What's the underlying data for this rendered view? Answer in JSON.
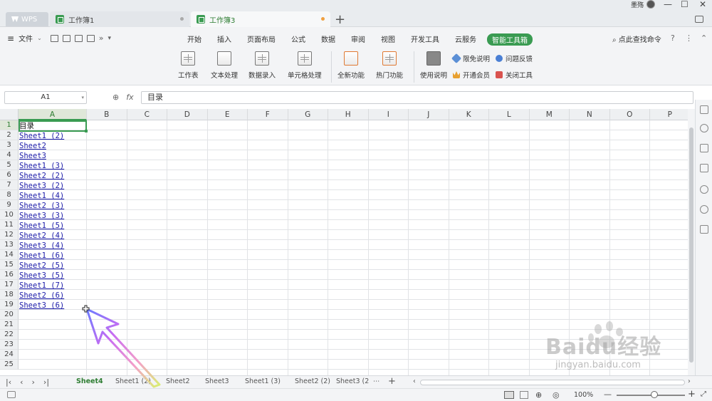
{
  "titlebar": {
    "tabs": [
      {
        "label": "WPS"
      },
      {
        "label": "工作簿1"
      },
      {
        "label": "工作簿3"
      }
    ],
    "user_name": "墨殇"
  },
  "ribbon": {
    "file_menu": "文件",
    "menu_tabs": [
      "开始",
      "插入",
      "页面布局",
      "公式",
      "数据",
      "审阅",
      "视图",
      "开发工具",
      "云服务",
      "智能工具箱"
    ],
    "active_tab": "智能工具箱",
    "search_placeholder": "点此查找命令",
    "groups": [
      {
        "label": "工作表",
        "icon": "worksheet-icon"
      },
      {
        "label": "文本处理",
        "icon": "text-process-icon"
      },
      {
        "label": "数据录入",
        "icon": "data-entry-icon"
      },
      {
        "label": "单元格处理",
        "icon": "cell-process-icon"
      },
      {
        "label": "全新功能",
        "icon": "new-features-icon"
      },
      {
        "label": "热门功能",
        "icon": "hot-features-icon"
      },
      {
        "label": "使用说明",
        "icon": "manual-icon"
      }
    ],
    "small_items": {
      "limited_free": "限免说明",
      "feedback": "问题反馈",
      "vip": "开通会员",
      "close_tools": "关闭工具"
    }
  },
  "formula_bar": {
    "name_box": "A1",
    "fx_label": "fx",
    "formula": "目录"
  },
  "grid": {
    "columns": [
      "A",
      "B",
      "C",
      "D",
      "E",
      "F",
      "G",
      "H",
      "I",
      "J",
      "K",
      "L",
      "M",
      "N",
      "O",
      "P"
    ],
    "rows": [
      "1",
      "2",
      "3",
      "4",
      "5",
      "6",
      "7",
      "8",
      "9",
      "10",
      "11",
      "12",
      "13",
      "14",
      "15",
      "16",
      "17",
      "18",
      "19",
      "20",
      "21",
      "22",
      "23",
      "24",
      "25"
    ],
    "cells_A": [
      "目录",
      "Sheet1 (2)",
      "Sheet2",
      "Sheet3",
      "Sheet1 (3)",
      "Sheet2 (2)",
      "Sheet3 (2)",
      "Sheet1 (4)",
      "Sheet2 (3)",
      "Sheet3 (3)",
      "Sheet1 (5)",
      "Sheet2 (4)",
      "Sheet3 (4)",
      "Sheet1 (6)",
      "Sheet2 (5)",
      "Sheet3 (5)",
      "Sheet1 (7)",
      "Sheet2 (6)",
      "Sheet3 (6)"
    ]
  },
  "sheet_tabs": [
    "Sheet4",
    "Sheet1 (2)",
    "Sheet2",
    "Sheet3",
    "Sheet1 (3)",
    "Sheet2 (2)",
    "Sheet3 (2"
  ],
  "active_sheet": "Sheet4",
  "status": {
    "zoom": "100%"
  },
  "watermark": {
    "main": "Baidu经验",
    "sub": "jingyan.baidu.com"
  },
  "colors": {
    "accent": "#3a9b52",
    "link": "#1a1aa8"
  }
}
